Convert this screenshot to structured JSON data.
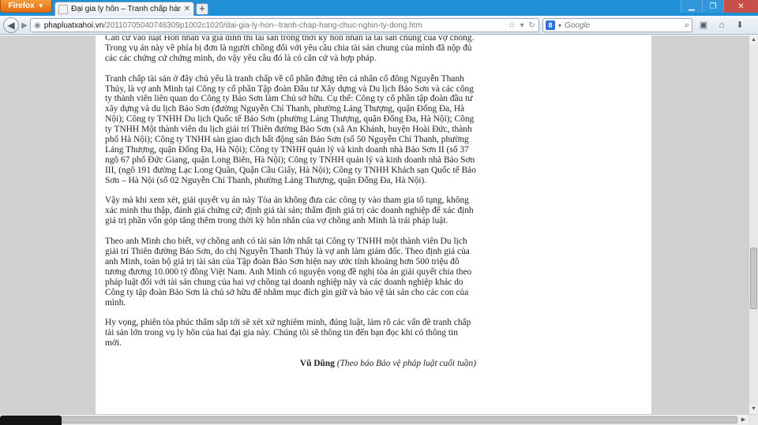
{
  "browser": {
    "menu_button_label": "Firefox",
    "tab": {
      "title": "Đại gia ly hôn – Tranh chấp hàng chục n..."
    },
    "new_tab_label": "+",
    "address": {
      "domain": "phapluatxahoi.vn",
      "path": "/20110705040746309p1002c1020/dai-gia-ly-hon--tranh-chap-hang-chuc-nghin-ty-dong.htm"
    },
    "search": {
      "placeholder": "Google",
      "engine_letter": "8"
    }
  },
  "article": {
    "paragraphs": [
      "Căn cứ vào luật Hôn nhân và gia đình thì tài sản trong thời kỳ hôn nhân là tài sản chung của vợ chồng. Trong vụ án này về phía bị đơn là người chồng đối  với yêu cầu chia tài sản chung của mình đã nộp đủ các các chứng cứ chứng minh, do vậy yêu cầu đó là có căn cứ và hợp pháp.",
      "Tranh chấp tài sản ở đây chủ yếu là tranh chấp về cổ phần  đứng tên cá nhân cổ đông Nguyễn Thanh Thủy, là vợ anh Minh tại Công ty cổ phần Tập đoàn Đầu tư Xây dựng và Du lịch Bảo Sơn và các công ty thành viên liên quan do Công ty Bảo Sơn làm Chủ sở hữu. Cụ thể: Công ty cổ phần tập đoàn đầu tư xây dựng và du lịch Bảo Sơn (đường Nguyễn Chí Thanh, phường Láng Thượng, quận Đống Đa, Hà Nội); Công ty TNHH Du lịch Quốc tế Bảo Sơn (phường Láng Thượng, quận Đống Đa, Hà Nội); Công ty TNHH Một thành viên du lịch giải trí Thiên đường Bảo Sơn (xã An Khánh, huyện Hoài Đức, thành phố Hà Nội); Công ty TNHH sàn giao dịch bất động sản Bảo Sơn (số 50 Nguyễn Chí Thanh, phường Láng Thượng, quận Đống Đa, Hà Nội); Công ty TNHH quản lý và kinh doanh nhà Bảo Sơn II (số 37 ngõ 67 phố Đức Giang, quận Long Biên, Hà Nội); Công ty TNHH quản lý và kinh doanh nhà Bảo Sơn III, (ngõ 191 đường Lạc Long Quân, Quận Cầu Giấy, Hà Nội); Công ty TNHH Khách sạn Quốc tế Bảo Sơn – Hà Nội (số 02 Nguyễn Chí Thanh, phường Láng Thượng, quận Đống Đa, Hà Nội).",
      "Vậy mà khi xem xét, giải quyết vụ án này Tòa án không đưa các công ty vào tham gia tố tụng, không xác minh thu thập, đánh giá chứng cứ; định giá tài sản; thẩm định giá trị các doanh nghiệp để xác định giá trị phần vốn góp tăng thêm trong thời kỳ hôn nhân của vợ chồng anh Minh là trái pháp luật.",
      "Theo anh Minh cho biết, vợ chồng anh có tài sản lớn nhất tại Công ty TNHH một thành viên Du lịch giải trí Thiên đường Bảo Sơn, do chị Nguyễn Thanh Thủy là vợ anh làm giám đốc. Theo định giá của anh Minh, toàn bộ giá trị tài sản của Tập đoàn Bảo Sơn hiện nay ước tính khoảng hơn 500 triệu đô tương đương 10.000 tỷ đồng Việt Nam. Anh Minh có nguyện vọng đề nghị tòa án giải quyết chia theo pháp luật đối với tài sản chung của hai vợ chồng tại doanh nghiệp này và các doanh nghiệp khác do Công ty tập đoàn Bảo Sơn là chủ sở hữu để nhằm mục đích gìn giữ và bảo vệ tài sản cho các con của mình.",
      "Hy vọng, phiên tòa phúc thẩm sắp tới sẽ xét xử nghiêm minh, đúng luật, làm rõ các vấn đề tranh chấp tài sản lớn trong vụ ly hôn của hai đại gia này.  Chúng tôi sẽ thông tin đến bạn đọc khi có thông tin mới."
    ],
    "author": "Vũ Dũng",
    "source": "(Theo báo Bảo vệ pháp luật cuối tuần)"
  },
  "scrollbars": {
    "vertical_position_fraction": 0.68
  }
}
